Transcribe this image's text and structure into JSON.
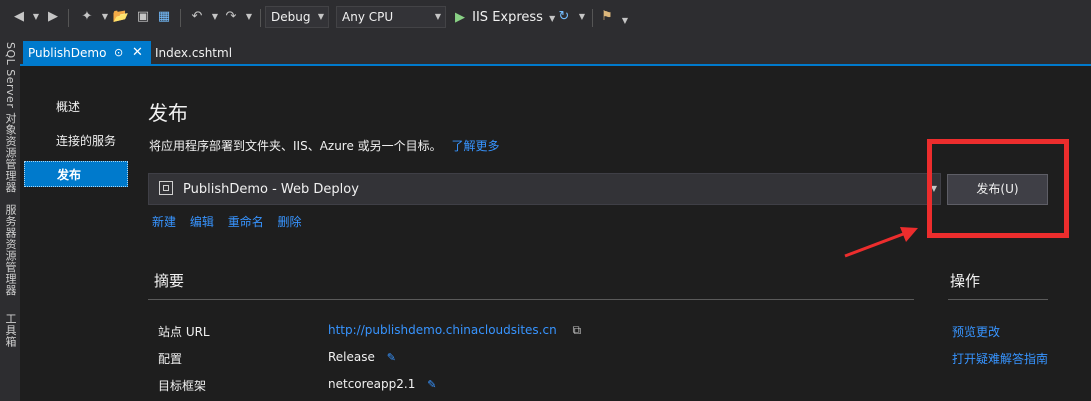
{
  "toolbar": {
    "config": "Debug",
    "platform": "Any CPU",
    "run_target": "IIS Express"
  },
  "left_strip": {
    "items": [
      "SQL Server 对象资源管理器",
      "服务器资源管理器",
      "工具箱"
    ]
  },
  "tabs": {
    "active": "PublishDemo",
    "inactive": "Index.cshtml"
  },
  "nav": {
    "items": [
      "概述",
      "连接的服务",
      "发布"
    ],
    "selected": "发布"
  },
  "main": {
    "title": "发布",
    "description": "将应用程序部署到文件夹、IIS、Azure 或另一个目标。",
    "learn_more": "了解更多",
    "profile": "PublishDemo - Web Deploy",
    "publish_button": "发布(U)",
    "profile_actions": [
      "新建",
      "编辑",
      "重命名",
      "删除"
    ]
  },
  "summary": {
    "title": "摘要",
    "rows": [
      {
        "label": "站点 URL",
        "value": "http://publishdemo.chinacloudsites.cn"
      },
      {
        "label": "配置",
        "value": "Release"
      },
      {
        "label": "目标框架",
        "value": "netcoreapp2.1"
      }
    ]
  },
  "operations": {
    "title": "操作",
    "links": [
      "预览更改",
      "打开疑难解答指南"
    ]
  },
  "colors": {
    "accent": "#007acc",
    "link": "#3794ff",
    "annotation": "#ec2d2d",
    "background": "#1e1e1e"
  }
}
